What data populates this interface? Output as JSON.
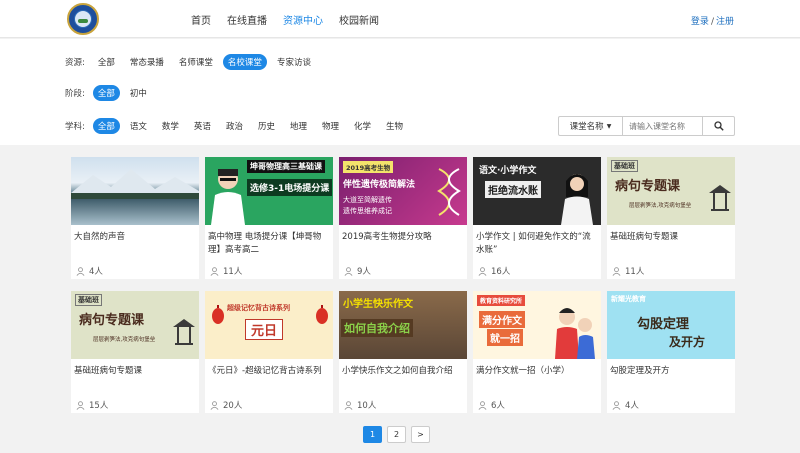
{
  "nav": {
    "items": [
      "首页",
      "在线直播",
      "资源中心",
      "校园新闻"
    ],
    "active_index": 2
  },
  "auth": {
    "login": "登录",
    "separator": "/",
    "register": "注册"
  },
  "filters": {
    "resource": {
      "label": "资源:",
      "options": [
        "全部",
        "常态录播",
        "名师课堂",
        "名校课堂",
        "专家访谈"
      ],
      "active_index": 3
    },
    "stage": {
      "label": "阶段:",
      "options": [
        "全部",
        "初中"
      ],
      "active_index": 0
    },
    "subject": {
      "label": "学科:",
      "options": [
        "全部",
        "语文",
        "数学",
        "英语",
        "政治",
        "历史",
        "地理",
        "物理",
        "化学",
        "生物"
      ],
      "active_index": 0
    }
  },
  "search": {
    "select_label": "课堂名称",
    "placeholder": "请输入课堂名称"
  },
  "cards": [
    {
      "title": "大自然的声音",
      "count": "4人",
      "thumb": "landscape"
    },
    {
      "title": "高中物理 电场提分课【坤哥物理】高考高二",
      "count": "11人",
      "thumb": "physics",
      "thumb_text": [
        "坤哥物理高三基础课",
        "选修3-1电场提分课"
      ]
    },
    {
      "title": "2019高考生物提分攻略",
      "count": "9人",
      "thumb": "biology",
      "thumb_text": [
        "2019高考生物",
        "伴性遗传极简解法",
        "大道至简解遗传",
        "遗传思维养成记"
      ]
    },
    {
      "title": "小学作文 | 如何避免作文的“流水账”",
      "count": "16人",
      "thumb": "essay",
      "thumb_text": [
        "语文·小学作文",
        "拒绝流水账"
      ]
    },
    {
      "title": "基础班病句专题课",
      "count": "11人",
      "thumb": "grammar",
      "thumb_text": [
        "基础班",
        "病句专题课",
        "层层剥笋法,攻克病句堡垒"
      ]
    },
    {
      "title": "基础班病句专题课",
      "count": "15人",
      "thumb": "grammar",
      "thumb_text": [
        "基础班",
        "病句专题课",
        "层层剥笋法,攻克病句堡垒"
      ]
    },
    {
      "title": "《元日》-超级记忆背古诗系列",
      "count": "20人",
      "thumb": "poem",
      "thumb_text": [
        "超级记忆背古诗系列",
        "元日"
      ]
    },
    {
      "title": "小学快乐作文之如何自我介绍",
      "count": "10人",
      "thumb": "intro",
      "thumb_text": [
        "小学生快乐作文",
        "如何自我介绍"
      ]
    },
    {
      "title": "满分作文就一招（小学）",
      "count": "6人",
      "thumb": "fullmark",
      "thumb_text": [
        "教育资料研究所",
        "满分作文",
        "就一招"
      ]
    },
    {
      "title": "勾股定理及开方",
      "count": "4人",
      "thumb": "math",
      "thumb_text": [
        "新耀光教育",
        "勾股定理",
        "及开方"
      ]
    }
  ],
  "pagination": {
    "pages": [
      "1",
      "2"
    ],
    "active_index": 0,
    "next": ">"
  },
  "colors": {
    "accent": "#1e88e5",
    "link": "#1e6fbf"
  }
}
